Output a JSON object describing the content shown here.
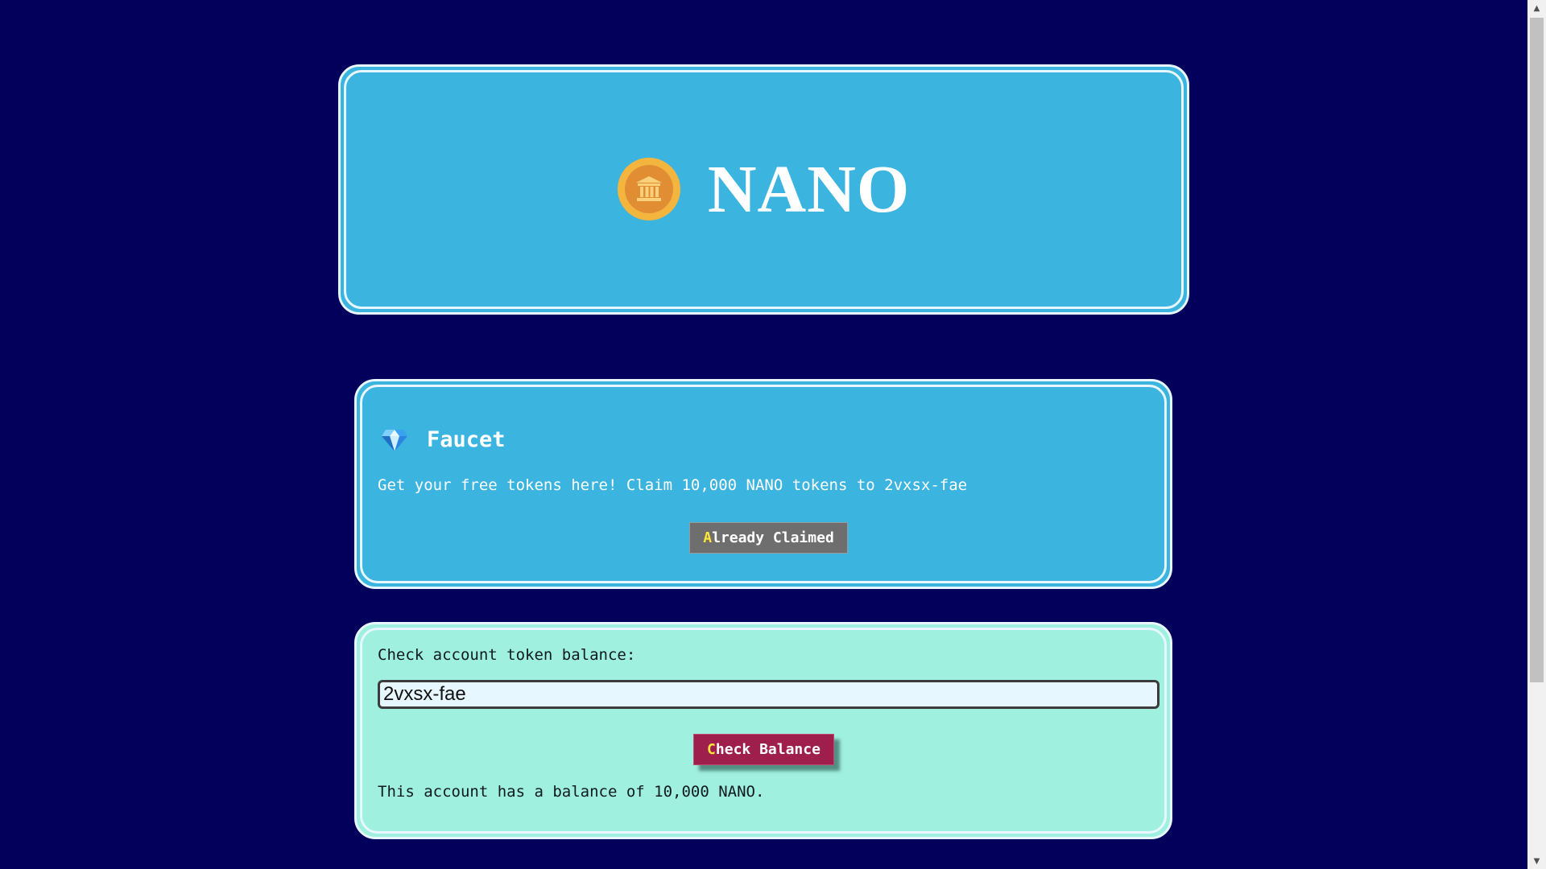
{
  "header": {
    "title": "NANO",
    "logo_icon": "bank-coin-icon"
  },
  "faucet": {
    "icon": "gem-icon",
    "title": "Faucet",
    "description": "Get your free tokens here! Claim 10,000 NANO tokens to 2vxsx-fae",
    "button": {
      "hotkey": "A",
      "rest": "lready Claimed"
    }
  },
  "balance": {
    "label": "Check account token balance:",
    "input_value": "2vxsx-fae",
    "button": {
      "hotkey": "C",
      "rest": "heck Balance"
    },
    "result": "This account has a balance of 10,000 NANO."
  },
  "colors": {
    "background": "#02005a",
    "card_blue": "#3bb4df",
    "card_mint": "#a0f0df",
    "disabled_button": "#6e6e6e",
    "primary_button": "#9e1e4c",
    "hotkey": "#ffe438"
  }
}
